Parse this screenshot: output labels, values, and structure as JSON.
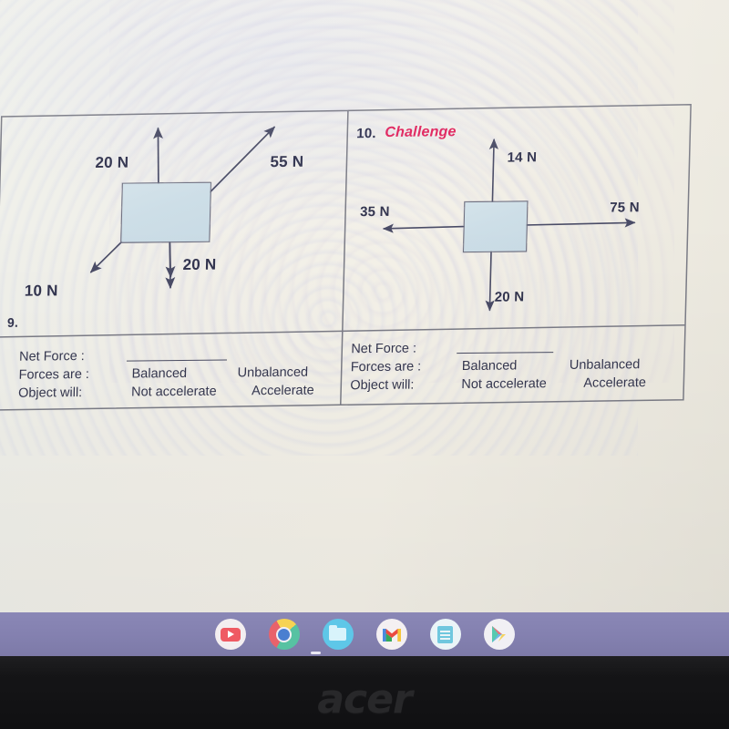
{
  "device": {
    "brand_logo": "acer",
    "bezel_color": "#131315"
  },
  "shelf": {
    "background_color": "#8481b0",
    "apps": [
      {
        "name": "youtube-icon",
        "label": "YouTube"
      },
      {
        "name": "chrome-icon",
        "label": "Google Chrome"
      },
      {
        "name": "files-icon",
        "label": "Files"
      },
      {
        "name": "gmail-icon",
        "label": "Gmail"
      },
      {
        "name": "docs-icon",
        "label": "Docs"
      },
      {
        "name": "play-store-icon",
        "label": "Play Store"
      }
    ]
  },
  "worksheet": {
    "accent_red": "#e0245e",
    "ink_color": "#32344f",
    "block_fill": "#cddee7",
    "problems": [
      {
        "number": "9.",
        "title": "",
        "forces": [
          {
            "label": "20 N",
            "direction": "up"
          },
          {
            "label": "55 N",
            "direction": "up-right"
          },
          {
            "label": "20 N",
            "direction": "down"
          },
          {
            "label": "10 N",
            "direction": "down-left"
          }
        ],
        "answers": {
          "net_force_label": "Net Force :",
          "net_force_value": "",
          "forces_are_label": "Forces are :",
          "forces_option_1": "Balanced",
          "forces_option_2": "Unbalanced",
          "object_will_label": "Object will:",
          "object_option_1": "Not accelerate",
          "object_option_2": "Accelerate"
        }
      },
      {
        "number": "10.",
        "title": "Challenge",
        "forces": [
          {
            "label": "14 N",
            "direction": "up"
          },
          {
            "label": "75 N",
            "direction": "right"
          },
          {
            "label": "35 N",
            "direction": "left"
          },
          {
            "label": "20 N",
            "direction": "down"
          }
        ],
        "answers": {
          "net_force_label": "Net Force :",
          "net_force_value": "",
          "forces_are_label": "Forces are :",
          "forces_option_1": "Balanced",
          "forces_option_2": "Unbalanced",
          "object_will_label": "Object will:",
          "object_option_1": "Not accelerate",
          "object_option_2": "Accelerate"
        }
      }
    ]
  },
  "chart_data": {
    "type": "diagram",
    "title": "Free-body force diagrams",
    "diagrams": [
      {
        "id": "problem-9",
        "label": "9.",
        "vectors": [
          {
            "magnitude": 20,
            "unit": "N",
            "angle_deg": 95,
            "label": "20 N"
          },
          {
            "magnitude": 55,
            "unit": "N",
            "angle_deg": 42,
            "label": "55 N"
          },
          {
            "magnitude": 20,
            "unit": "N",
            "angle_deg": 270,
            "label": "20 N"
          },
          {
            "magnitude": 10,
            "unit": "N",
            "angle_deg": 215,
            "label": "10 N"
          }
        ]
      },
      {
        "id": "problem-10",
        "label": "10. Challenge",
        "vectors": [
          {
            "magnitude": 14,
            "unit": "N",
            "angle_deg": 90,
            "label": "14 N"
          },
          {
            "magnitude": 75,
            "unit": "N",
            "angle_deg": 0,
            "label": "75 N"
          },
          {
            "magnitude": 35,
            "unit": "N",
            "angle_deg": 180,
            "label": "35 N"
          },
          {
            "magnitude": 20,
            "unit": "N",
            "angle_deg": 270,
            "label": "20 N"
          }
        ]
      }
    ]
  }
}
